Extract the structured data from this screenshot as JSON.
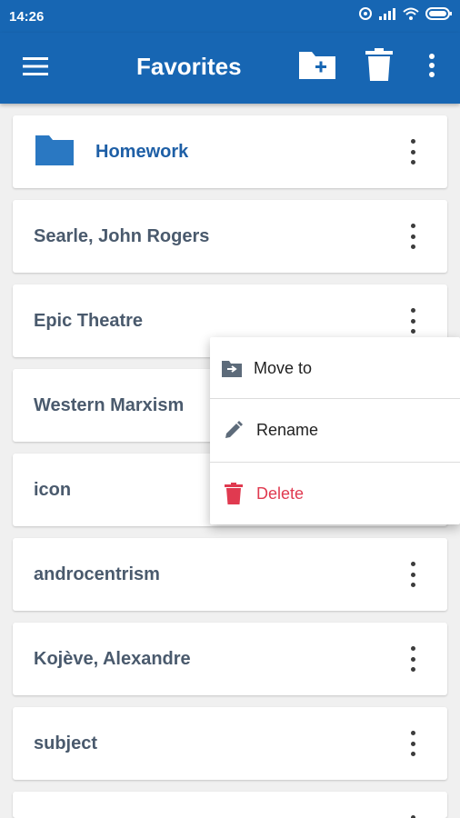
{
  "status_bar": {
    "time": "14:26"
  },
  "app_bar": {
    "title": "Favorites"
  },
  "items": [
    {
      "label": "Homework",
      "type": "folder"
    },
    {
      "label": "Searle, John Rogers",
      "type": "entry"
    },
    {
      "label": "Epic Theatre",
      "type": "entry"
    },
    {
      "label": "Western Marxism",
      "type": "entry"
    },
    {
      "label": "icon",
      "type": "entry"
    },
    {
      "label": "androcentrism",
      "type": "entry"
    },
    {
      "label": "Kojève, Alexandre",
      "type": "entry"
    },
    {
      "label": "subject",
      "type": "entry"
    }
  ],
  "context_menu": {
    "move_label": "Move to",
    "rename_label": "Rename",
    "delete_label": "Delete"
  },
  "colors": {
    "primary": "#1766b3",
    "folder": "#2a78c2",
    "delete": "#e03a50",
    "entry_text": "#4a5a6d"
  }
}
